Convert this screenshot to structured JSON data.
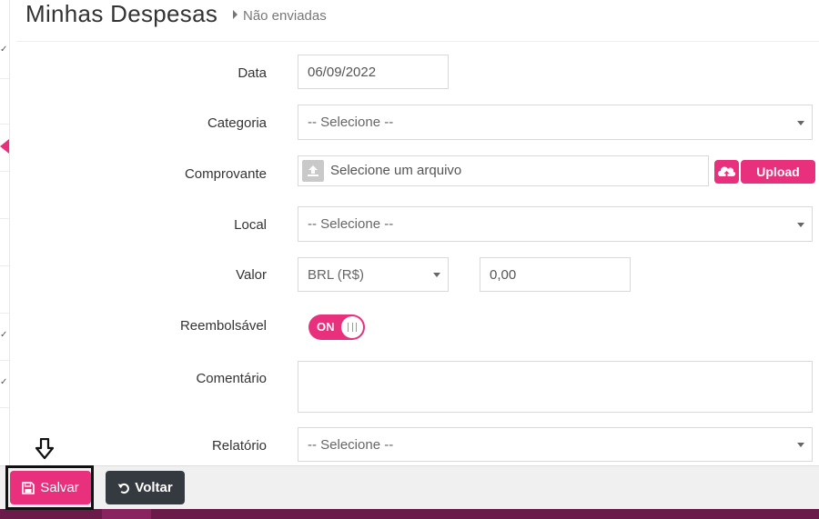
{
  "header": {
    "title": "Minhas Despesas",
    "breadcrumb": "Não enviadas"
  },
  "form": {
    "data": {
      "label": "Data",
      "value": "06/09/2022"
    },
    "categoria": {
      "label": "Categoria",
      "value": "-- Selecione --"
    },
    "comprovante": {
      "label": "Comprovante",
      "placeholder": "Selecione um arquivo",
      "upload_label": "Upload"
    },
    "local": {
      "label": "Local",
      "value": "-- Selecione --"
    },
    "valor": {
      "label": "Valor",
      "currency": "BRL (R$)",
      "amount": "0,00"
    },
    "reembolsavel": {
      "label": "Reembolsável",
      "state": "ON"
    },
    "comentario": {
      "label": "Comentário",
      "value": ""
    },
    "relatorio": {
      "label": "Relatório",
      "value": "-- Selecione --"
    }
  },
  "footer": {
    "save_label": "Salvar",
    "back_label": "Voltar"
  },
  "colors": {
    "accent": "#e8307d",
    "dark_button": "#343a40",
    "bottom_bar": "#6a1b49"
  },
  "icons": [
    "save-icon",
    "undo-icon",
    "cloud-upload-icon",
    "file-upload-icon",
    "caret-right-icon",
    "caret-down-icon",
    "down-arrow-icon"
  ]
}
